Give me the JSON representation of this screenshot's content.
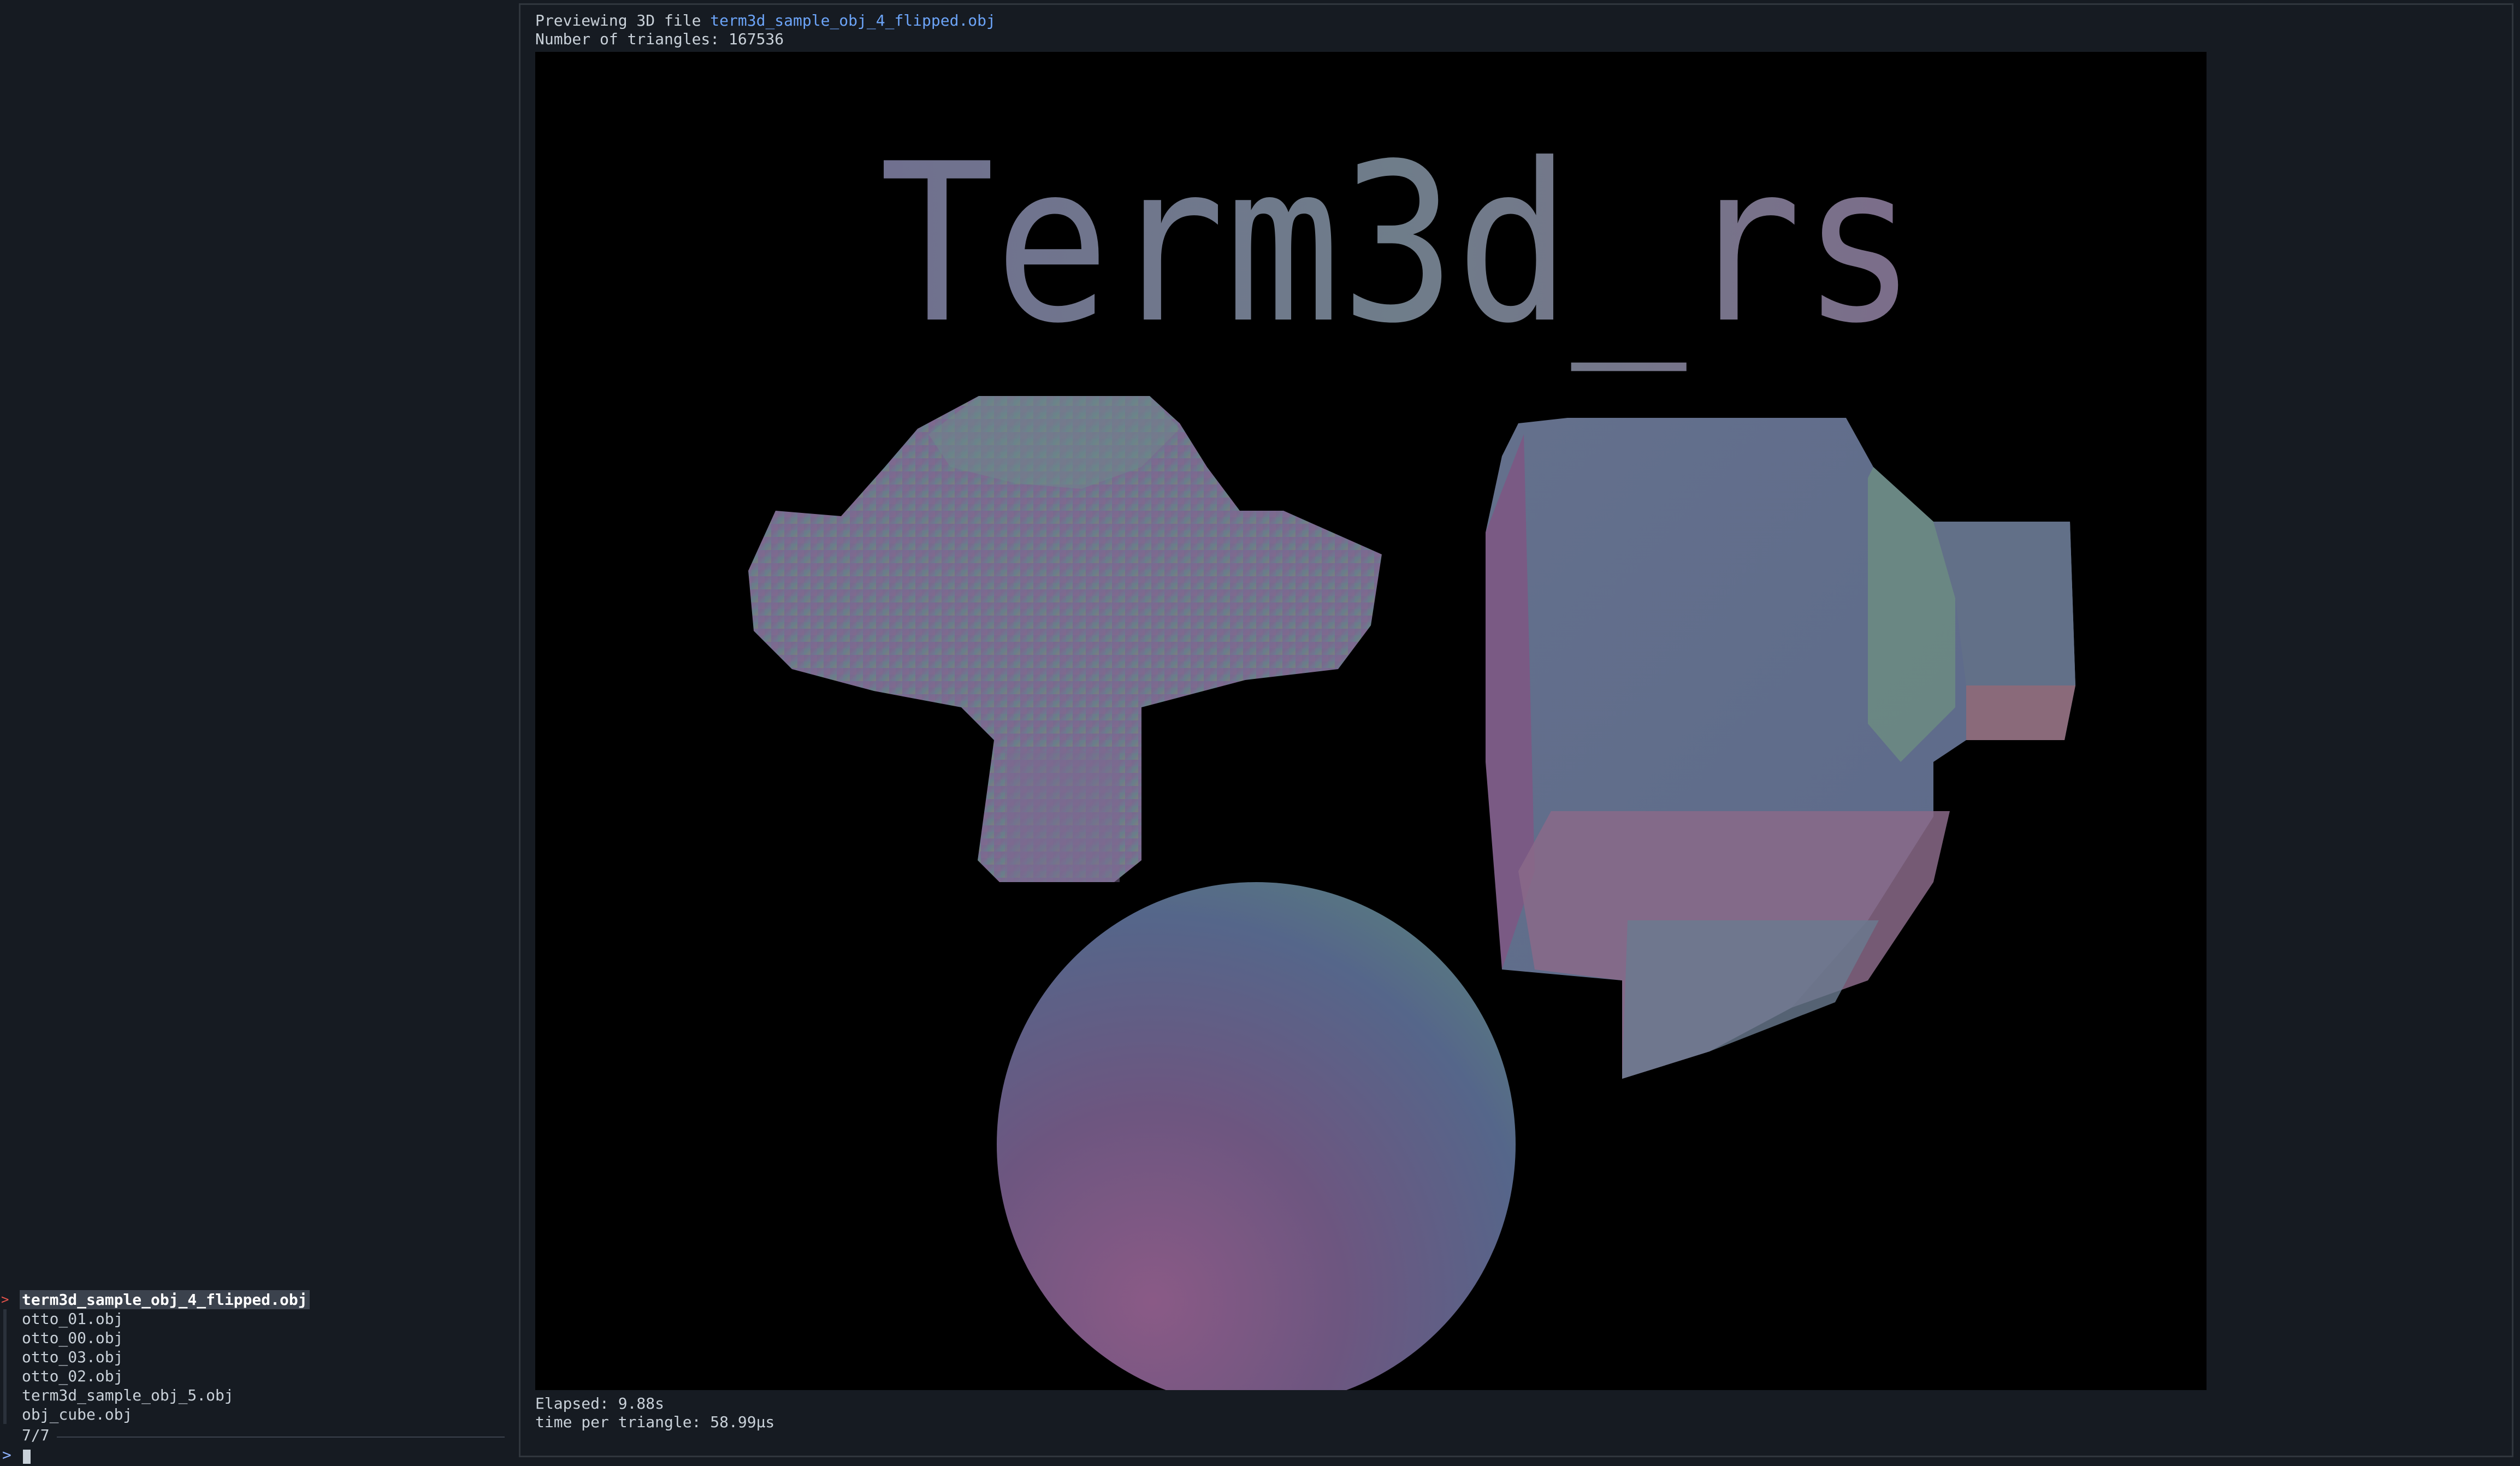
{
  "file_list": {
    "items": [
      {
        "label": "term3d_sample_obj_4_flipped.obj",
        "selected": true
      },
      {
        "label": "otto_01.obj",
        "selected": false
      },
      {
        "label": "otto_00.obj",
        "selected": false
      },
      {
        "label": "otto_03.obj",
        "selected": false
      },
      {
        "label": "otto_02.obj",
        "selected": false
      },
      {
        "label": "term3d_sample_obj_5.obj",
        "selected": false
      },
      {
        "label": "obj_cube.obj",
        "selected": false
      }
    ],
    "selected_caret": ">",
    "match_count": "7/7"
  },
  "prompt": {
    "symbol": ">",
    "query": ""
  },
  "preview": {
    "previewing_prefix": "Previewing 3D file ",
    "filename": "term3d_sample_obj_4_flipped.obj",
    "triangles_line": "Number of triangles: 167536",
    "elapsed": "Elapsed: 9.88s",
    "time_per_triangle": "time per triangle: 58.99µs"
  },
  "render": {
    "title_text": "Term3d_rs",
    "objects": [
      "monkey-head",
      "sphere",
      "rounded-cube"
    ],
    "colors": {
      "background": "#000000",
      "text_fill": "#6e6e8e",
      "accent_link": "#6ca4f8"
    }
  }
}
